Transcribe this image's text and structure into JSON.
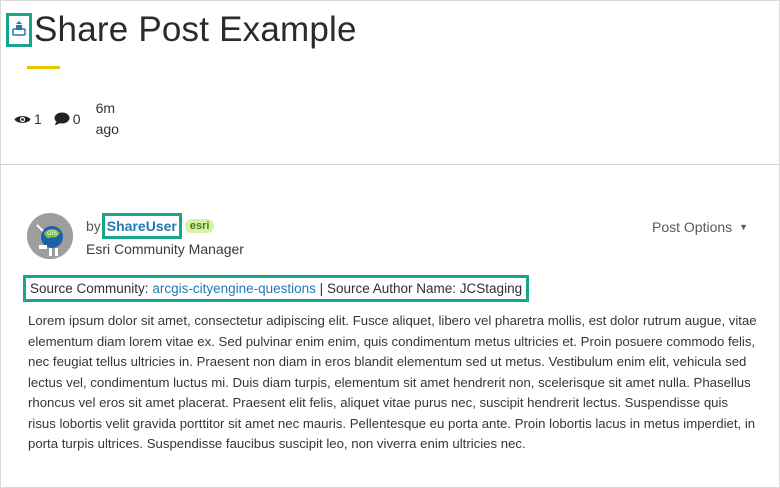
{
  "post": {
    "title": "Share Post Example",
    "views": "1",
    "comments": "0",
    "time_ago": "6m ago"
  },
  "author": {
    "by_label": "by",
    "username": "ShareUser",
    "badge": "esri",
    "role": "Esri Community Manager"
  },
  "post_options_label": "Post Options",
  "source": {
    "community_label": "Source Community:",
    "community_link": "arcgis-cityengine-questions",
    "separator": "|",
    "author_label": "Source Author Name:",
    "author_name": "JCStaging"
  },
  "body": "Lorem ipsum dolor sit amet, consectetur adipiscing elit. Fusce aliquet, libero vel pharetra mollis, est dolor rutrum augue, vitae elementum diam lorem vitae ex. Sed pulvinar enim enim, quis condimentum metus ultricies et. Proin posuere commodo felis, nec feugiat tellus ultricies in. Praesent non diam in eros blandit elementum sed ut metus. Vestibulum enim elit, vehicula sed lectus vel, condimentum luctus mi. Duis diam turpis, elementum sit amet hendrerit non, scelerisque sit amet nulla. Phasellus rhoncus vel eros sit amet placerat. Praesent elit felis, aliquet vitae purus nec, suscipit hendrerit lectus. Suspendisse quis risus lobortis velit gravida porttitor sit amet nec mauris. Pellentesque eu porta ante. Proin lobortis lacus in metus imperdiet, in porta turpis ultrices. Suspendisse faucibus suscipit leo, non viverra enim ultricies nec.",
  "colors": {
    "highlight": "#17a68c",
    "link": "#2279b5",
    "accent_underline": "#e5c800"
  },
  "icons": [
    "share-post-icon",
    "eye-icon",
    "comment-icon",
    "caret-down-icon"
  ]
}
